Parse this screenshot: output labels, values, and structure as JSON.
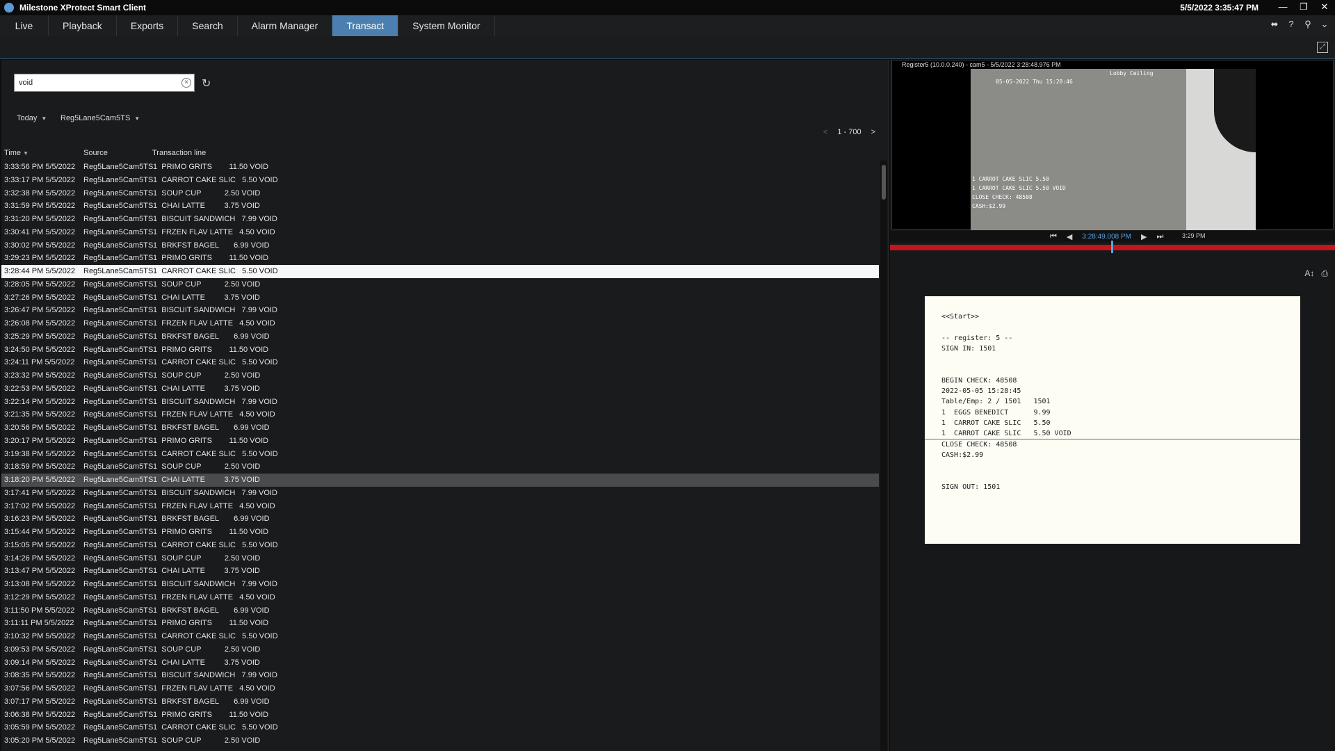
{
  "window": {
    "title": "Milestone XProtect Smart Client",
    "clock": "5/5/2022 3:35:47 PM",
    "controls": [
      "—",
      "❐",
      "✕"
    ]
  },
  "tabs": [
    {
      "label": "Live",
      "active": false
    },
    {
      "label": "Playback",
      "active": false
    },
    {
      "label": "Exports",
      "active": false
    },
    {
      "label": "Search",
      "active": false
    },
    {
      "label": "Alarm Manager",
      "active": false
    },
    {
      "label": "Transact",
      "active": true
    },
    {
      "label": "System Monitor",
      "active": false
    }
  ],
  "search": {
    "value": "void"
  },
  "filters": {
    "period": "Today",
    "source": "Reg5Lane5Cam5TS"
  },
  "pager": {
    "prev": "<",
    "range": "1 - 700",
    "next": ">"
  },
  "columns": {
    "time": "Time",
    "source": "Source",
    "line": "Transaction line"
  },
  "rows": [
    {
      "time": "3:33:56 PM 5/5/2022",
      "source": "Reg5Lane5Cam5TS",
      "line": "1  PRIMO GRITS        11.50 VOID"
    },
    {
      "time": "3:33:17 PM 5/5/2022",
      "source": "Reg5Lane5Cam5TS",
      "line": "1  CARROT CAKE SLIC   5.50 VOID"
    },
    {
      "time": "3:32:38 PM 5/5/2022",
      "source": "Reg5Lane5Cam5TS",
      "line": "1  SOUP CUP           2.50 VOID"
    },
    {
      "time": "3:31:59 PM 5/5/2022",
      "source": "Reg5Lane5Cam5TS",
      "line": "1  CHAI LATTE         3.75 VOID"
    },
    {
      "time": "3:31:20 PM 5/5/2022",
      "source": "Reg5Lane5Cam5TS",
      "line": "1  BISCUIT SANDWICH   7.99 VOID"
    },
    {
      "time": "3:30:41 PM 5/5/2022",
      "source": "Reg5Lane5Cam5TS",
      "line": "1  FRZEN FLAV LATTE   4.50 VOID"
    },
    {
      "time": "3:30:02 PM 5/5/2022",
      "source": "Reg5Lane5Cam5TS",
      "line": "1  BRKFST BAGEL       6.99 VOID"
    },
    {
      "time": "3:29:23 PM 5/5/2022",
      "source": "Reg5Lane5Cam5TS",
      "line": "1  PRIMO GRITS        11.50 VOID"
    },
    {
      "time": "3:28:44 PM 5/5/2022",
      "source": "Reg5Lane5Cam5TS",
      "line": "1  CARROT CAKE SLIC   5.50 VOID",
      "state": "selected"
    },
    {
      "time": "3:28:05 PM 5/5/2022",
      "source": "Reg5Lane5Cam5TS",
      "line": "1  SOUP CUP           2.50 VOID"
    },
    {
      "time": "3:27:26 PM 5/5/2022",
      "source": "Reg5Lane5Cam5TS",
      "line": "1  CHAI LATTE         3.75 VOID"
    },
    {
      "time": "3:26:47 PM 5/5/2022",
      "source": "Reg5Lane5Cam5TS",
      "line": "1  BISCUIT SANDWICH   7.99 VOID"
    },
    {
      "time": "3:26:08 PM 5/5/2022",
      "source": "Reg5Lane5Cam5TS",
      "line": "1  FRZEN FLAV LATTE   4.50 VOID"
    },
    {
      "time": "3:25:29 PM 5/5/2022",
      "source": "Reg5Lane5Cam5TS",
      "line": "1  BRKFST BAGEL       6.99 VOID"
    },
    {
      "time": "3:24:50 PM 5/5/2022",
      "source": "Reg5Lane5Cam5TS",
      "line": "1  PRIMO GRITS        11.50 VOID"
    },
    {
      "time": "3:24:11 PM 5/5/2022",
      "source": "Reg5Lane5Cam5TS",
      "line": "1  CARROT CAKE SLIC   5.50 VOID"
    },
    {
      "time": "3:23:32 PM 5/5/2022",
      "source": "Reg5Lane5Cam5TS",
      "line": "1  SOUP CUP           2.50 VOID"
    },
    {
      "time": "3:22:53 PM 5/5/2022",
      "source": "Reg5Lane5Cam5TS",
      "line": "1  CHAI LATTE         3.75 VOID"
    },
    {
      "time": "3:22:14 PM 5/5/2022",
      "source": "Reg5Lane5Cam5TS",
      "line": "1  BISCUIT SANDWICH   7.99 VOID"
    },
    {
      "time": "3:21:35 PM 5/5/2022",
      "source": "Reg5Lane5Cam5TS",
      "line": "1  FRZEN FLAV LATTE   4.50 VOID"
    },
    {
      "time": "3:20:56 PM 5/5/2022",
      "source": "Reg5Lane5Cam5TS",
      "line": "1  BRKFST BAGEL       6.99 VOID"
    },
    {
      "time": "3:20:17 PM 5/5/2022",
      "source": "Reg5Lane5Cam5TS",
      "line": "1  PRIMO GRITS        11.50 VOID"
    },
    {
      "time": "3:19:38 PM 5/5/2022",
      "source": "Reg5Lane5Cam5TS",
      "line": "1  CARROT CAKE SLIC   5.50 VOID"
    },
    {
      "time": "3:18:59 PM 5/5/2022",
      "source": "Reg5Lane5Cam5TS",
      "line": "1  SOUP CUP           2.50 VOID"
    },
    {
      "time": "3:18:20 PM 5/5/2022",
      "source": "Reg5Lane5Cam5TS",
      "line": "1  CHAI LATTE         3.75 VOID",
      "state": "hover"
    },
    {
      "time": "3:17:41 PM 5/5/2022",
      "source": "Reg5Lane5Cam5TS",
      "line": "1  BISCUIT SANDWICH   7.99 VOID"
    },
    {
      "time": "3:17:02 PM 5/5/2022",
      "source": "Reg5Lane5Cam5TS",
      "line": "1  FRZEN FLAV LATTE   4.50 VOID"
    },
    {
      "time": "3:16:23 PM 5/5/2022",
      "source": "Reg5Lane5Cam5TS",
      "line": "1  BRKFST BAGEL       6.99 VOID"
    },
    {
      "time": "3:15:44 PM 5/5/2022",
      "source": "Reg5Lane5Cam5TS",
      "line": "1  PRIMO GRITS        11.50 VOID"
    },
    {
      "time": "3:15:05 PM 5/5/2022",
      "source": "Reg5Lane5Cam5TS",
      "line": "1  CARROT CAKE SLIC   5.50 VOID"
    },
    {
      "time": "3:14:26 PM 5/5/2022",
      "source": "Reg5Lane5Cam5TS",
      "line": "1  SOUP CUP           2.50 VOID"
    },
    {
      "time": "3:13:47 PM 5/5/2022",
      "source": "Reg5Lane5Cam5TS",
      "line": "1  CHAI LATTE         3.75 VOID"
    },
    {
      "time": "3:13:08 PM 5/5/2022",
      "source": "Reg5Lane5Cam5TS",
      "line": "1  BISCUIT SANDWICH   7.99 VOID"
    },
    {
      "time": "3:12:29 PM 5/5/2022",
      "source": "Reg5Lane5Cam5TS",
      "line": "1  FRZEN FLAV LATTE   4.50 VOID"
    },
    {
      "time": "3:11:50 PM 5/5/2022",
      "source": "Reg5Lane5Cam5TS",
      "line": "1  BRKFST BAGEL       6.99 VOID"
    },
    {
      "time": "3:11:11 PM 5/5/2022",
      "source": "Reg5Lane5Cam5TS",
      "line": "1  PRIMO GRITS        11.50 VOID"
    },
    {
      "time": "3:10:32 PM 5/5/2022",
      "source": "Reg5Lane5Cam5TS",
      "line": "1  CARROT CAKE SLIC   5.50 VOID"
    },
    {
      "time": "3:09:53 PM 5/5/2022",
      "source": "Reg5Lane5Cam5TS",
      "line": "1  SOUP CUP           2.50 VOID"
    },
    {
      "time": "3:09:14 PM 5/5/2022",
      "source": "Reg5Lane5Cam5TS",
      "line": "1  CHAI LATTE         3.75 VOID"
    },
    {
      "time": "3:08:35 PM 5/5/2022",
      "source": "Reg5Lane5Cam5TS",
      "line": "1  BISCUIT SANDWICH   7.99 VOID"
    },
    {
      "time": "3:07:56 PM 5/5/2022",
      "source": "Reg5Lane5Cam5TS",
      "line": "1  FRZEN FLAV LATTE   4.50 VOID"
    },
    {
      "time": "3:07:17 PM 5/5/2022",
      "source": "Reg5Lane5Cam5TS",
      "line": "1  BRKFST BAGEL       6.99 VOID"
    },
    {
      "time": "3:06:38 PM 5/5/2022",
      "source": "Reg5Lane5Cam5TS",
      "line": "1  PRIMO GRITS        11.50 VOID"
    },
    {
      "time": "3:05:59 PM 5/5/2022",
      "source": "Reg5Lane5Cam5TS",
      "line": "1  CARROT CAKE SLIC   5.50 VOID"
    },
    {
      "time": "3:05:20 PM 5/5/2022",
      "source": "Reg5Lane5Cam5TS",
      "line": "1  SOUP CUP           2.50 VOID"
    }
  ],
  "video": {
    "title": "Register5 (10.0.0.240) - cam5 - 5/5/2022 3:28:48.976 PM",
    "overlay_camera": "Lobby Ceiling",
    "overlay_datetime": "05-05-2022 Thu 15:28:46",
    "overlay_lines": [
      "1  CARROT CAKE SLIC   5.50",
      "1  CARROT CAKE SLIC   5.50 VOID",
      "CLOSE CHECK: 48508",
      "CASH:$2.99"
    ],
    "timeline_current": "3:28:49.008 PM",
    "timeline_end": "3:29 PM",
    "icons": [
      "step-back-icon",
      "play-reverse-icon",
      "play-icon",
      "step-forward-icon"
    ]
  },
  "receipt_lines": [
    "<<Start>>",
    "",
    "-- register: 5 --",
    "SIGN IN: 1501",
    "",
    "",
    "BEGIN CHECK: 48508",
    "2022-05-05 15:28:45",
    "Table/Emp: 2 / 1501   1501",
    "1  EGGS BENEDICT      9.99",
    "1  CARROT CAKE SLIC   5.50",
    "1  CARROT CAKE SLIC   5.50 VOID",
    "CLOSE CHECK: 48508",
    "CASH:$2.99",
    "",
    "",
    "SIGN OUT: 1501"
  ],
  "colors": {
    "accent": "#4a7fb0",
    "timeline": "#c2161b",
    "receipt_bg": "#fdfdf3"
  }
}
